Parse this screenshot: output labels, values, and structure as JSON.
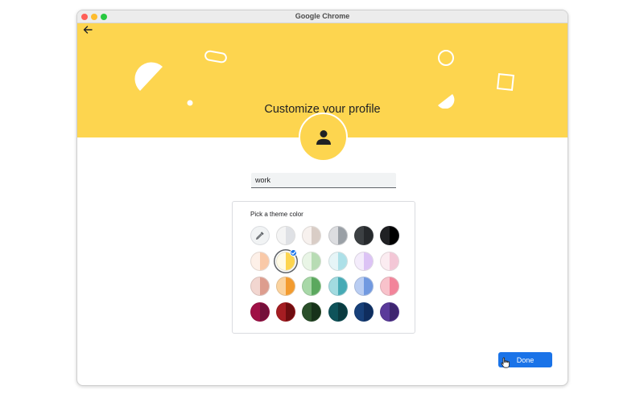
{
  "window": {
    "title": "Google Chrome"
  },
  "header": {
    "title": "Customize your profile"
  },
  "profile": {
    "name_value": "work",
    "name_placeholder": ""
  },
  "theme": {
    "label": "Pick a theme color",
    "selected_index": 7,
    "colors": [
      {
        "left": "#ffffff",
        "right": "#ffffff",
        "kind": "picker"
      },
      {
        "left": "#f4f4f4",
        "right": "#dfe1e5"
      },
      {
        "left": "#f7f1ee",
        "right": "#d9cdc6"
      },
      {
        "left": "#dcdde0",
        "right": "#9aa0a6"
      },
      {
        "left": "#3c4043",
        "right": "#26292c"
      },
      {
        "left": "#202124",
        "right": "#000000"
      },
      {
        "left": "#fdf0e8",
        "right": "#f9c9a8"
      },
      {
        "left": "#fffbe6",
        "right": "#fdd54f"
      },
      {
        "left": "#e9f5e6",
        "right": "#b8dcb4"
      },
      {
        "left": "#e6f5f7",
        "right": "#ade0e8"
      },
      {
        "left": "#f4ecfb",
        "right": "#dcc3f5"
      },
      {
        "left": "#fbecf1",
        "right": "#f3c7d6"
      },
      {
        "left": "#f2d6d0",
        "right": "#dd9d8e"
      },
      {
        "left": "#fbd39f",
        "right": "#f39b2e"
      },
      {
        "left": "#a8d8a8",
        "right": "#5ba85e"
      },
      {
        "left": "#a2dbe0",
        "right": "#46aab5"
      },
      {
        "left": "#b9cdf2",
        "right": "#7199e0"
      },
      {
        "left": "#f8c2cb",
        "right": "#f2849a"
      },
      {
        "left": "#a01046",
        "right": "#74103a"
      },
      {
        "left": "#a51d22",
        "right": "#6f0d10"
      },
      {
        "left": "#2a4f2a",
        "right": "#17321a"
      },
      {
        "left": "#0e535a",
        "right": "#0a3b40"
      },
      {
        "left": "#17407a",
        "right": "#0f2d5e"
      },
      {
        "left": "#5a3a9a",
        "right": "#3e2570"
      }
    ]
  },
  "actions": {
    "done_label": "Done"
  },
  "icons": {
    "back": "arrow-left-icon",
    "avatar": "person-icon",
    "picker": "eyedropper-icon",
    "check": "check-icon"
  },
  "colors": {
    "banner": "#fdd54f",
    "accent": "#1a73e8"
  }
}
